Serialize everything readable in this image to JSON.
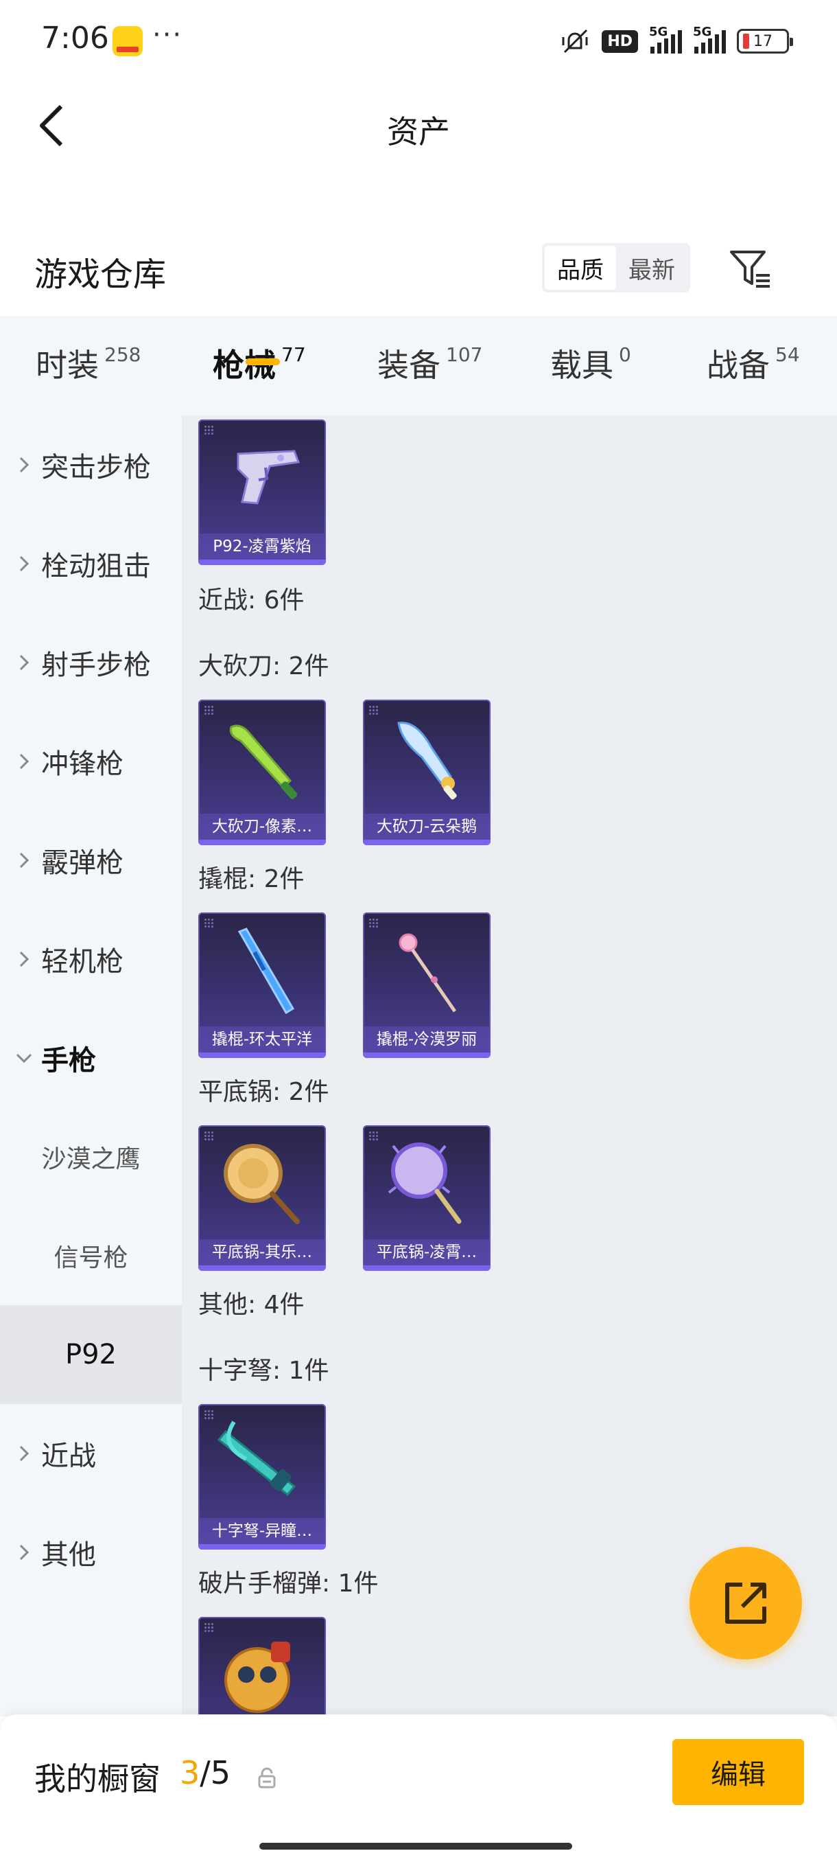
{
  "status_bar": {
    "time": "7:06",
    "dots": "···",
    "hd_label": "HD",
    "net_1": "5G",
    "net_2": "5G",
    "battery_level": "17"
  },
  "header": {
    "title": "资产"
  },
  "warehouse": {
    "title": "游戏仓库",
    "sort_options": [
      "品质",
      "最新"
    ],
    "sort_active": "品质"
  },
  "tabs": [
    {
      "label": "时装",
      "count": "258"
    },
    {
      "label": "枪械",
      "count": "77"
    },
    {
      "label": "装备",
      "count": "107"
    },
    {
      "label": "载具",
      "count": "0"
    },
    {
      "label": "战备",
      "count": "54"
    }
  ],
  "sidebar": {
    "categories": [
      {
        "label": "突击步枪"
      },
      {
        "label": "栓动狙击"
      },
      {
        "label": "射手步枪"
      },
      {
        "label": "冲锋枪"
      },
      {
        "label": "霰弹枪"
      },
      {
        "label": "轻机枪"
      },
      {
        "label": "手枪"
      },
      {
        "label": "近战"
      },
      {
        "label": "其他"
      }
    ],
    "sub_items": [
      {
        "label": "沙漠之鹰"
      },
      {
        "label": "信号枪"
      },
      {
        "label": "P92"
      }
    ]
  },
  "content": {
    "items": [
      {
        "name": "P92-凌霄紫焰",
        "icon": "pistol-icon"
      },
      {
        "name": "大砍刀-像素…",
        "icon": "machete-green-icon"
      },
      {
        "name": "大砍刀-云朵鹅",
        "icon": "machete-cloud-icon"
      },
      {
        "name": "撬棍-环太平洋",
        "icon": "crowbar-blue-icon"
      },
      {
        "name": "撬棍-冷漠罗丽",
        "icon": "crowbar-pink-icon"
      },
      {
        "name": "平底锅-其乐…",
        "icon": "pan-gold-icon"
      },
      {
        "name": "平底锅-凌霄…",
        "icon": "pan-purple-icon"
      },
      {
        "name": "十字弩-异瞳…",
        "icon": "crossbow-icon"
      },
      {
        "name": "",
        "icon": "grenade-icon"
      }
    ],
    "sections": [
      {
        "label": "近战: 6件"
      },
      {
        "label": "大砍刀: 2件"
      },
      {
        "label": "撬棍: 2件"
      },
      {
        "label": "平底锅: 2件"
      },
      {
        "label": "其他: 4件"
      },
      {
        "label": "十字弩: 1件"
      },
      {
        "label": "破片手榴弹: 1件"
      }
    ]
  },
  "bottom_bar": {
    "title": "我的橱窗",
    "count_current": "3",
    "count_total": "/5",
    "edit_label": "编辑"
  },
  "colors": {
    "accent": "#ffb400",
    "card_bg": "#3a3270",
    "card_border": "#5d51b8"
  }
}
